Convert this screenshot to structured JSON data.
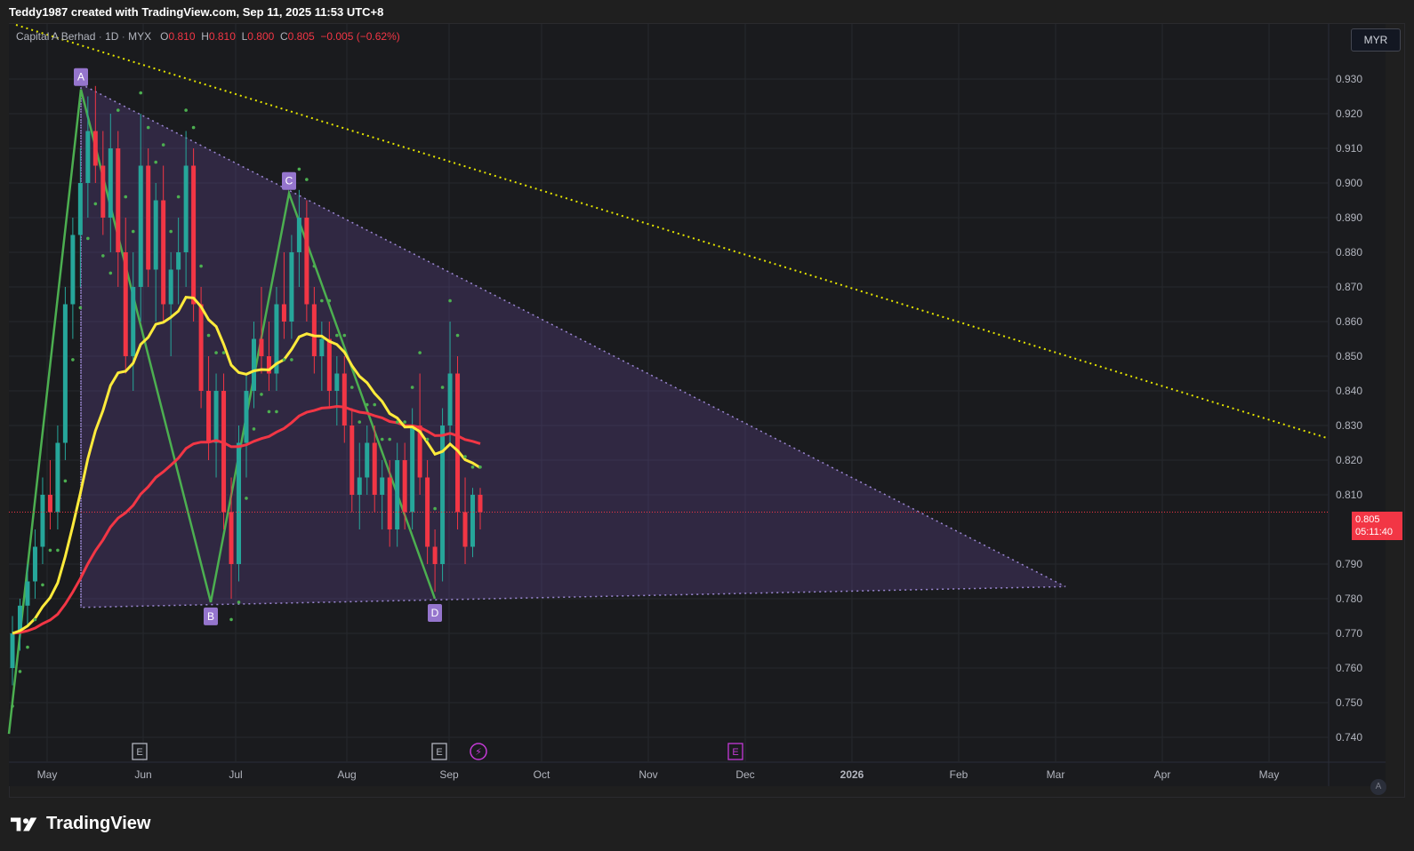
{
  "header": {
    "caption": "Teddy1987 created with TradingView.com, Sep 11, 2025 11:53 UTC+8"
  },
  "legend": {
    "symbol": "Capital A Berhad",
    "interval": "1D",
    "exchange": "MYX",
    "open_label": "O",
    "open": "0.810",
    "high_label": "H",
    "high": "0.810",
    "low_label": "L",
    "low": "0.800",
    "close_label": "C",
    "close": "0.805",
    "change": "−0.005 (−0.62%)"
  },
  "currency": "MYR",
  "last_price": {
    "value": "0.805",
    "countdown": "05:11:40"
  },
  "brand": "TradingView",
  "auto_label": "A",
  "colors": {
    "up": "#26a69a",
    "down": "#f23645",
    "ema_fast": "#ffeb3b",
    "ema_slow": "#f23645",
    "pattern_line": "#4caf50",
    "pattern_fill": "#7e57c2",
    "trendline": "#e5e500",
    "dots": "#4caf50"
  },
  "chart_data": {
    "type": "candlestick",
    "y_axis": {
      "ticks": [
        "0.930",
        "0.920",
        "0.910",
        "0.900",
        "0.890",
        "0.880",
        "0.870",
        "0.860",
        "0.850",
        "0.840",
        "0.830",
        "0.820",
        "0.810",
        "0.790",
        "0.780",
        "0.770",
        "0.760",
        "0.750",
        "0.740"
      ],
      "ylim": [
        0.7365,
        0.9465
      ]
    },
    "x_axis": {
      "ticks": [
        "May",
        "Jun",
        "Jul",
        "Aug",
        "Sep",
        "Oct",
        "Nov",
        "Dec",
        "2026",
        "Feb",
        "Mar",
        "Apr",
        "May"
      ]
    },
    "candles": [
      [
        0.76,
        0.775,
        0.755,
        0.77
      ],
      [
        0.77,
        0.78,
        0.765,
        0.778
      ],
      [
        0.778,
        0.79,
        0.772,
        0.785
      ],
      [
        0.785,
        0.8,
        0.78,
        0.795
      ],
      [
        0.795,
        0.815,
        0.79,
        0.81
      ],
      [
        0.81,
        0.82,
        0.8,
        0.805
      ],
      [
        0.805,
        0.83,
        0.8,
        0.825
      ],
      [
        0.825,
        0.87,
        0.82,
        0.865
      ],
      [
        0.865,
        0.89,
        0.855,
        0.885
      ],
      [
        0.885,
        0.91,
        0.87,
        0.9
      ],
      [
        0.9,
        0.925,
        0.89,
        0.915
      ],
      [
        0.915,
        0.928,
        0.9,
        0.905
      ],
      [
        0.905,
        0.915,
        0.885,
        0.89
      ],
      [
        0.89,
        0.92,
        0.88,
        0.91
      ],
      [
        0.91,
        0.915,
        0.87,
        0.88
      ],
      [
        0.88,
        0.89,
        0.845,
        0.85
      ],
      [
        0.85,
        0.88,
        0.84,
        0.87
      ],
      [
        0.87,
        0.92,
        0.86,
        0.905
      ],
      [
        0.905,
        0.91,
        0.87,
        0.875
      ],
      [
        0.875,
        0.9,
        0.86,
        0.895
      ],
      [
        0.895,
        0.905,
        0.86,
        0.865
      ],
      [
        0.865,
        0.88,
        0.85,
        0.875
      ],
      [
        0.875,
        0.89,
        0.865,
        0.88
      ],
      [
        0.88,
        0.915,
        0.87,
        0.905
      ],
      [
        0.905,
        0.91,
        0.86,
        0.865
      ],
      [
        0.865,
        0.87,
        0.835,
        0.84
      ],
      [
        0.84,
        0.85,
        0.82,
        0.825
      ],
      [
        0.825,
        0.845,
        0.815,
        0.84
      ],
      [
        0.84,
        0.845,
        0.8,
        0.805
      ],
      [
        0.805,
        0.815,
        0.78,
        0.79
      ],
      [
        0.79,
        0.83,
        0.785,
        0.825
      ],
      [
        0.825,
        0.845,
        0.815,
        0.84
      ],
      [
        0.84,
        0.86,
        0.835,
        0.855
      ],
      [
        0.855,
        0.87,
        0.845,
        0.85
      ],
      [
        0.85,
        0.86,
        0.84,
        0.845
      ],
      [
        0.845,
        0.87,
        0.84,
        0.865
      ],
      [
        0.865,
        0.88,
        0.855,
        0.86
      ],
      [
        0.86,
        0.885,
        0.855,
        0.88
      ],
      [
        0.88,
        0.898,
        0.87,
        0.89
      ],
      [
        0.89,
        0.895,
        0.86,
        0.865
      ],
      [
        0.865,
        0.87,
        0.845,
        0.85
      ],
      [
        0.85,
        0.86,
        0.84,
        0.855
      ],
      [
        0.855,
        0.86,
        0.835,
        0.84
      ],
      [
        0.84,
        0.85,
        0.83,
        0.845
      ],
      [
        0.845,
        0.85,
        0.825,
        0.83
      ],
      [
        0.83,
        0.835,
        0.805,
        0.81
      ],
      [
        0.81,
        0.825,
        0.8,
        0.815
      ],
      [
        0.815,
        0.83,
        0.81,
        0.825
      ],
      [
        0.825,
        0.83,
        0.805,
        0.81
      ],
      [
        0.81,
        0.82,
        0.8,
        0.815
      ],
      [
        0.815,
        0.82,
        0.795,
        0.8
      ],
      [
        0.8,
        0.825,
        0.795,
        0.82
      ],
      [
        0.82,
        0.825,
        0.8,
        0.805
      ],
      [
        0.805,
        0.835,
        0.8,
        0.83
      ],
      [
        0.83,
        0.845,
        0.81,
        0.815
      ],
      [
        0.815,
        0.82,
        0.79,
        0.795
      ],
      [
        0.795,
        0.8,
        0.782,
        0.79
      ],
      [
        0.79,
        0.835,
        0.785,
        0.83
      ],
      [
        0.83,
        0.86,
        0.825,
        0.845
      ],
      [
        0.845,
        0.85,
        0.8,
        0.805
      ],
      [
        0.805,
        0.815,
        0.79,
        0.795
      ],
      [
        0.795,
        0.812,
        0.792,
        0.81
      ],
      [
        0.81,
        0.812,
        0.8,
        0.805
      ]
    ],
    "pattern_points": [
      {
        "label": "A",
        "value": 0.927
      },
      {
        "label": "B",
        "value": 0.779
      },
      {
        "label": "C",
        "value": 0.897
      },
      {
        "label": "D",
        "value": 0.78
      }
    ],
    "events": [
      {
        "label": "E"
      },
      {
        "label": "E"
      },
      {
        "label": "⚡"
      },
      {
        "label": "E"
      }
    ]
  }
}
